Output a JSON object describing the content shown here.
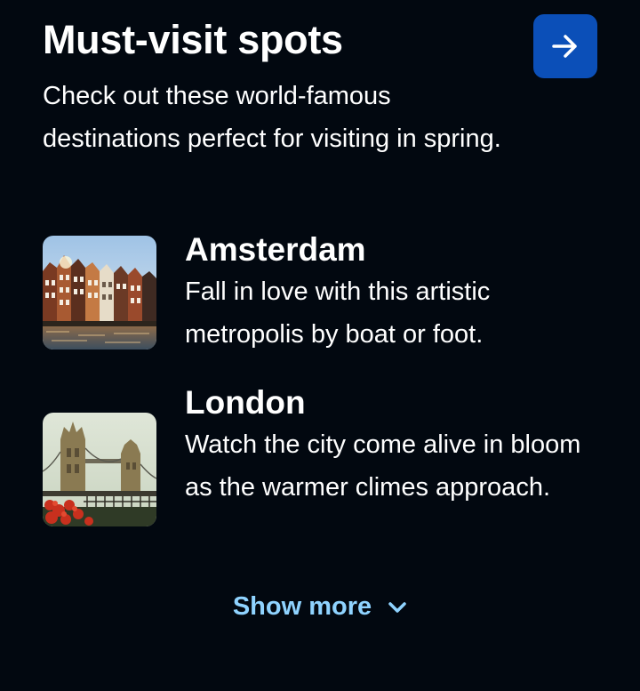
{
  "header": {
    "title": "Must-visit spots",
    "subtitle": "Check out these world-famous destinations perfect for visiting in spring.",
    "action_icon": "arrow-right-icon"
  },
  "destinations": [
    {
      "name": "Amsterdam",
      "description": "Fall in love with this artistic metropolis by boat or foot.",
      "image_icon": "amsterdam-canal-houses-photo"
    },
    {
      "name": "London",
      "description": "Watch the city come alive in bloom as the warmer climes approach.",
      "image_icon": "tower-bridge-photo"
    }
  ],
  "footer": {
    "show_more_label": "Show more",
    "show_more_icon": "chevron-down-icon"
  },
  "colors": {
    "background": "#020810",
    "button": "#0b4fb8",
    "link": "#8fd3ff",
    "text": "#ffffff"
  }
}
